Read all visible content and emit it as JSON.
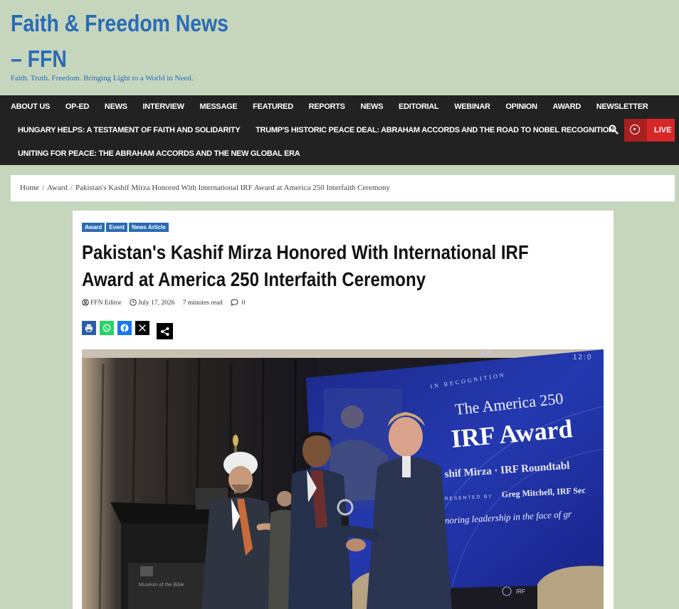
{
  "site": {
    "title": "Faith & Freedom News – FFN",
    "tagline": "Faith. Truth. Freedom. Bringing Light to a World in Need."
  },
  "nav": {
    "row1": [
      "ABOUT US",
      "OP-ED",
      "NEWS",
      "INTERVIEW",
      "MESSAGE",
      "FEATURED",
      "REPORTS",
      "NEWS",
      "EDITORIAL",
      "WEBINAR",
      "OPINION",
      "AWARD",
      "NEWSLETTER"
    ],
    "row2": [
      "HUNGARY HELPS: A TESTAMENT OF FAITH AND SOLIDARITY",
      "TRUMP'S HISTORIC PEACE DEAL: ABRAHAM ACCORDS AND THE ROAD TO NOBEL RECOGNITION"
    ],
    "row3": [
      "UNITING FOR PEACE: THE ABRAHAM ACCORDS AND THE NEW GLOBAL ERA"
    ],
    "live_label": "LIVE"
  },
  "breadcrumb": {
    "home": "Home",
    "section": "Award",
    "current": "Pakistan's Kashif Mirza Honored With International IRF Award at America 250 Interfaith Ceremony"
  },
  "article": {
    "categories": [
      "Award",
      "Event",
      "News Article"
    ],
    "headline": "Pakistan's Kashif Mirza Honored With International IRF Award at America 250 Interfaith Ceremony",
    "author": "FFN Editor",
    "date": "July 17, 2026",
    "read_time": "7 minutes read",
    "comments": "0"
  },
  "photo": {
    "screen_title_1": "The America 250",
    "screen_title_2": "IRF Award",
    "screen_kicker": "IN RECOGNITION",
    "screen_top": "AM",
    "screen_top_right": "12:0",
    "screen_name_line": "shif Mirza · IRF Roundtabl",
    "screen_presented_by": "RESENTED BY",
    "screen_presenter": "Greg Mitchell, IRF Sec",
    "screen_motto": "noring leadership in the face of gr",
    "screen_footer": "IRF",
    "podium_text": "Museum of the Bible"
  },
  "colors": {
    "page_bg": "#c5d6bd",
    "brand_blue": "#2a6bb5",
    "nav_bg": "#222222",
    "live_red": "#d62828",
    "whatsapp": "#25d366",
    "facebook": "#1877f2"
  },
  "icons": [
    "search-icon",
    "live-icon",
    "user-icon",
    "clock-icon",
    "comment-icon",
    "print-icon",
    "whatsapp-icon",
    "facebook-icon",
    "x-icon",
    "share-icon"
  ]
}
